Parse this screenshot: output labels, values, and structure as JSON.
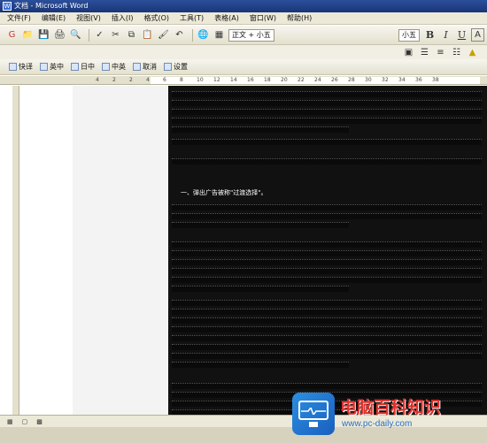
{
  "window": {
    "title": "文档 - Microsoft Word"
  },
  "menu": [
    "文件(F)",
    "编辑(E)",
    "视图(V)",
    "插入(I)",
    "格式(O)",
    "工具(T)",
    "表格(A)",
    "窗口(W)",
    "帮助(H)"
  ],
  "toolbar": {
    "style_combo": "正文 + 小五",
    "size_combo": "小五",
    "bold": "B",
    "italic": "I",
    "underline": "U",
    "font_color": "A"
  },
  "switch_bar": {
    "buttons": [
      "快译",
      "英中",
      "日中",
      "中英",
      "取消",
      "设置"
    ]
  },
  "ruler": {
    "ticks": [
      "4",
      "2",
      "2",
      "4",
      "6",
      "8",
      "10",
      "12",
      "14",
      "16",
      "18",
      "20",
      "22",
      "24",
      "26",
      "28",
      "30",
      "32",
      "34",
      "36",
      "38"
    ]
  },
  "document": {
    "heading": "一、弹出广告被称\"过渡选择\"。"
  },
  "watermark": {
    "title": "电脑百科知识",
    "url": "www.pc-daily.com"
  },
  "colors": {
    "selection": "#000000",
    "watermark_red": "#e0312b",
    "watermark_blue": "#2a6fc9"
  }
}
